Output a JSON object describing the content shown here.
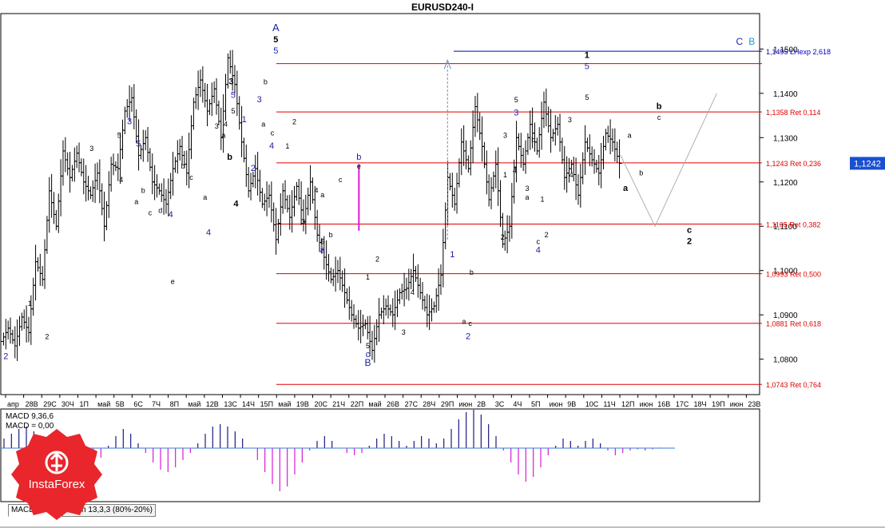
{
  "window": {
    "title": "EURUSD240-I"
  },
  "current_price": "1,1242",
  "tabs": [
    {
      "label": "MACD 9,36,6",
      "active": true
    },
    {
      "label": "Stoch 13,3,3 (80%-20%)",
      "active": false
    }
  ],
  "indicator": {
    "line1": "MACD 9,36,6",
    "line2": "MACD = 0,00"
  },
  "logo_text": "InstaForex",
  "colors": {
    "red_line": "#e00000",
    "blue_line": "#0000c0",
    "label_blue": "#1d1da8",
    "macd_pos": "#1b1b80",
    "macd_neg": "#d81bd8",
    "logo_red": "#e8262c"
  },
  "chart_data": {
    "type": "ohlc",
    "symbol": "EURUSD240-I",
    "y_ticks": [
      "1,1500",
      "1,1400",
      "1,1300",
      "1,1200",
      "1,1100",
      "1,1000",
      "1,0900",
      "1,0800"
    ],
    "ylim": [
      1.072,
      1.158
    ],
    "x_ticks": [
      "апр",
      "28В",
      "29С",
      "30Ч",
      "1П",
      "май",
      "5В",
      "6С",
      "7Ч",
      "8П",
      "май",
      "12В",
      "13С",
      "14Ч",
      "15П",
      "май",
      "19В",
      "20С",
      "21Ч",
      "22П",
      "май",
      "26В",
      "27С",
      "28Ч",
      "29П",
      "июн",
      "2В",
      "3С",
      "4Ч",
      "5П",
      "июн",
      "9В",
      "10С",
      "11Ч",
      "12П",
      "июн",
      "16В",
      "17С",
      "18Ч",
      "19П",
      "июн",
      "23В"
    ],
    "levels": [
      {
        "price": 1.1495,
        "label": "1,1495 LHexp 2,618",
        "color": "blue"
      },
      {
        "price": 1.1467,
        "label": "",
        "color": "red"
      },
      {
        "price": 1.1358,
        "label": "1,1358 Ret 0,114",
        "color": "red"
      },
      {
        "price": 1.1243,
        "label": "1,1243 Ret 0,236",
        "color": "red"
      },
      {
        "price": 1.1105,
        "label": "1,1105 Ret 0,382",
        "color": "red"
      },
      {
        "price": 1.0993,
        "label": "1,0993 Ret 0,500",
        "color": "red"
      },
      {
        "price": 1.0881,
        "label": "1,0881 Ret 0,618",
        "color": "red"
      },
      {
        "price": 1.0743,
        "label": "1,0743 Ret 0,764",
        "color": "red"
      }
    ],
    "price_path": [
      [
        0,
        1.084
      ],
      [
        1,
        1.087
      ],
      [
        2,
        1.083
      ],
      [
        3,
        1.0895
      ],
      [
        4,
        1.086
      ],
      [
        5,
        1.102
      ],
      [
        6,
        1.098
      ],
      [
        7,
        1.118
      ],
      [
        8,
        1.11
      ],
      [
        9,
        1.127
      ],
      [
        10,
        1.121
      ],
      [
        11,
        1.1265
      ],
      [
        12,
        1.12
      ],
      [
        13,
        1.117
      ],
      [
        14,
        1.122
      ],
      [
        15,
        1.11
      ],
      [
        16,
        1.124
      ],
      [
        17,
        1.123
      ],
      [
        18,
        1.136
      ],
      [
        19,
        1.139
      ],
      [
        20,
        1.126
      ],
      [
        21,
        1.13
      ],
      [
        22,
        1.12
      ],
      [
        23,
        1.118
      ],
      [
        24,
        1.115
      ],
      [
        25,
        1.123
      ],
      [
        26,
        1.128
      ],
      [
        27,
        1.122
      ],
      [
        28,
        1.138
      ],
      [
        29,
        1.143
      ],
      [
        30,
        1.136
      ],
      [
        31,
        1.141
      ],
      [
        32,
        1.13
      ],
      [
        33,
        1.148
      ],
      [
        34,
        1.142
      ],
      [
        35,
        1.129
      ],
      [
        36,
        1.118
      ],
      [
        37,
        1.123
      ],
      [
        38,
        1.115
      ],
      [
        39,
        1.117
      ],
      [
        40,
        1.107
      ],
      [
        41,
        1.118
      ],
      [
        42,
        1.112
      ],
      [
        43,
        1.119
      ],
      [
        44,
        1.111
      ],
      [
        45,
        1.12
      ],
      [
        46,
        1.108
      ],
      [
        47,
        1.103
      ],
      [
        48,
        1.098
      ],
      [
        49,
        1.1
      ],
      [
        50,
        1.095
      ],
      [
        51,
        1.09
      ],
      [
        52,
        1.087
      ],
      [
        53,
        1.088
      ],
      [
        54,
        1.082
      ],
      [
        55,
        1.09
      ],
      [
        56,
        1.092
      ],
      [
        57,
        1.09
      ],
      [
        58,
        1.095
      ],
      [
        59,
        1.096
      ],
      [
        60,
        1.1
      ],
      [
        61,
        1.095
      ],
      [
        62,
        1.09
      ],
      [
        63,
        1.092
      ],
      [
        64,
        1.099
      ],
      [
        65,
        1.121
      ],
      [
        66,
        1.115
      ],
      [
        67,
        1.129
      ],
      [
        68,
        1.123
      ],
      [
        69,
        1.137
      ],
      [
        70,
        1.128
      ],
      [
        71,
        1.116
      ],
      [
        72,
        1.124
      ],
      [
        73,
        1.106
      ],
      [
        74,
        1.11
      ],
      [
        75,
        1.13
      ],
      [
        76,
        1.124
      ],
      [
        77,
        1.133
      ],
      [
        78,
        1.127
      ],
      [
        79,
        1.138
      ],
      [
        80,
        1.13
      ],
      [
        81,
        1.133
      ],
      [
        82,
        1.121
      ],
      [
        83,
        1.124
      ],
      [
        84,
        1.117
      ],
      [
        85,
        1.129
      ],
      [
        86,
        1.125
      ],
      [
        87,
        1.122
      ],
      [
        88,
        1.131
      ],
      [
        89,
        1.129
      ],
      [
        90,
        1.1242
      ]
    ],
    "projection": [
      [
        90,
        1.126
      ],
      [
        95,
        1.11
      ],
      [
        104,
        1.14
      ]
    ],
    "macd_histogram": [
      0.4,
      0.6,
      0.8,
      0.9,
      0.7,
      0.4,
      0.1,
      -0.3,
      -0.7,
      -1.0,
      -1.2,
      -1.1,
      -0.8,
      -0.4,
      0.1,
      0.5,
      0.8,
      0.6,
      0.2,
      -0.2,
      -0.6,
      -0.9,
      -1.0,
      -0.8,
      -0.5,
      -0.2,
      0.2,
      0.6,
      0.9,
      1.0,
      0.9,
      0.7,
      0.4,
      0.0,
      -0.5,
      -1.0,
      -1.5,
      -1.8,
      -1.6,
      -1.1,
      -0.6,
      -0.1,
      0.3,
      0.5,
      0.3,
      0.0,
      -0.2,
      -0.3,
      -0.2,
      0.1,
      0.4,
      0.6,
      0.5,
      0.3,
      0.1,
      0.3,
      0.5,
      0.4,
      0.2,
      0.4,
      0.8,
      1.2,
      1.5,
      1.6,
      1.4,
      1.0,
      0.5,
      -0.1,
      -0.6,
      -1.1,
      -1.4,
      -1.2,
      -0.8,
      -0.3,
      0.1,
      0.4,
      0.3,
      0.1,
      0.3,
      0.4,
      0.2,
      -0.1,
      -0.3,
      -0.2,
      -0.1,
      -0.05,
      -0.1,
      -0.05,
      0.02,
      0.0,
      0.0
    ],
    "wave_labels": [
      {
        "x": 0.5,
        "p": 1.08,
        "t": "2",
        "c": "blue",
        "s": 11
      },
      {
        "x": 4,
        "p": 1.092,
        "t": "1",
        "c": "black",
        "s": 9
      },
      {
        "x": 6.5,
        "p": 1.0845,
        "t": "2",
        "c": "black",
        "s": 9
      },
      {
        "x": 13,
        "p": 1.127,
        "t": "3",
        "c": "black",
        "s": 9
      },
      {
        "x": 17,
        "p": 1.13,
        "t": "5",
        "c": "black",
        "s": 9
      },
      {
        "x": 18.5,
        "p": 1.133,
        "t": "3",
        "c": "blue",
        "s": 11
      },
      {
        "x": 19.8,
        "p": 1.128,
        "t": "5",
        "c": "blue",
        "s": 11
      },
      {
        "x": 17.3,
        "p": 1.12,
        "t": "4",
        "c": "black",
        "s": 9
      },
      {
        "x": 19.5,
        "p": 1.115,
        "t": "a",
        "c": "black",
        "s": 9
      },
      {
        "x": 20.5,
        "p": 1.1175,
        "t": "b",
        "c": "black",
        "s": 9
      },
      {
        "x": 21.5,
        "p": 1.1125,
        "t": "c",
        "c": "black",
        "s": 9
      },
      {
        "x": 23,
        "p": 1.113,
        "t": "d",
        "c": "black",
        "s": 9
      },
      {
        "x": 24.5,
        "p": 1.112,
        "t": "4",
        "c": "blue",
        "s": 11
      },
      {
        "x": 24.8,
        "p": 1.097,
        "t": "e",
        "c": "black",
        "s": 9
      },
      {
        "x": 26.3,
        "p": 1.123,
        "t": "b",
        "c": "black",
        "s": 9
      },
      {
        "x": 27.5,
        "p": 1.1205,
        "t": "c",
        "c": "black",
        "s": 9
      },
      {
        "x": 29.5,
        "p": 1.116,
        "t": "a",
        "c": "black",
        "s": 9
      },
      {
        "x": 30,
        "p": 1.108,
        "t": "4",
        "c": "blue",
        "s": 11
      },
      {
        "x": 31.2,
        "p": 1.132,
        "t": "3",
        "c": "black",
        "s": 9
      },
      {
        "x": 32.5,
        "p": 1.1325,
        "t": "4",
        "c": "black",
        "s": 9
      },
      {
        "x": 33.3,
        "p": 1.142,
        "t": "3",
        "c": "black",
        "s": 11
      },
      {
        "x": 33.6,
        "p": 1.139,
        "t": "5",
        "c": "blue",
        "s": 11
      },
      {
        "x": 33.6,
        "p": 1.1355,
        "t": "5",
        "c": "black",
        "s": 9
      },
      {
        "x": 32.2,
        "p": 1.13,
        "t": "a",
        "c": "black",
        "s": 9
      },
      {
        "x": 33.1,
        "p": 1.125,
        "t": "b",
        "c": "black",
        "s": 11
      },
      {
        "x": 34,
        "p": 1.1145,
        "t": "4",
        "c": "black",
        "s": 11
      },
      {
        "x": 35.2,
        "p": 1.1335,
        "t": "1",
        "c": "blue",
        "s": 11
      },
      {
        "x": 36.5,
        "p": 1.1225,
        "t": "2",
        "c": "blue",
        "s": 11
      },
      {
        "x": 37.4,
        "p": 1.138,
        "t": "3",
        "c": "blue",
        "s": 11
      },
      {
        "x": 39.8,
        "p": 1.154,
        "t": "A",
        "c": "blue",
        "s": 13
      },
      {
        "x": 39.8,
        "p": 1.1515,
        "t": "5",
        "c": "black",
        "s": 11
      },
      {
        "x": 39.8,
        "p": 1.149,
        "t": "5",
        "c": "blue",
        "s": 11
      },
      {
        "x": 38.3,
        "p": 1.142,
        "t": "b",
        "c": "black",
        "s": 9
      },
      {
        "x": 38.0,
        "p": 1.1325,
        "t": "a",
        "c": "black",
        "s": 9
      },
      {
        "x": 39.3,
        "p": 1.1305,
        "t": "c",
        "c": "black",
        "s": 9
      },
      {
        "x": 39.2,
        "p": 1.1275,
        "t": "4",
        "c": "blue",
        "s": 11
      },
      {
        "x": 42.5,
        "p": 1.133,
        "t": "2",
        "c": "black",
        "s": 9
      },
      {
        "x": 41.5,
        "p": 1.1275,
        "t": "1",
        "c": "black",
        "s": 9
      },
      {
        "x": 43.8,
        "p": 1.1105,
        "t": "3",
        "c": "black",
        "s": 9
      },
      {
        "x": 45.7,
        "p": 1.1175,
        "t": "4",
        "c": "black",
        "s": 9
      },
      {
        "x": 46.6,
        "p": 1.1165,
        "t": "a",
        "c": "black",
        "s": 9
      },
      {
        "x": 49.2,
        "p": 1.12,
        "t": "c",
        "c": "black",
        "s": 9
      },
      {
        "x": 46.6,
        "p": 1.106,
        "t": "5",
        "c": "black",
        "s": 9
      },
      {
        "x": 47.8,
        "p": 1.1075,
        "t": "b",
        "c": "black",
        "s": 9
      },
      {
        "x": 46.6,
        "p": 1.104,
        "t": "a",
        "c": "blue",
        "s": 11
      },
      {
        "x": 51.9,
        "p": 1.125,
        "t": "b",
        "c": "blue",
        "s": 11
      },
      {
        "x": 51.9,
        "p": 1.123,
        "t": "e",
        "c": "black",
        "s": 9
      },
      {
        "x": 53.2,
        "p": 1.0785,
        "t": "B",
        "c": "blue",
        "s": 12
      },
      {
        "x": 53.2,
        "p": 1.0805,
        "t": "c",
        "c": "blue",
        "s": 11
      },
      {
        "x": 53.2,
        "p": 1.0825,
        "t": "5",
        "c": "black",
        "s": 9
      },
      {
        "x": 54.6,
        "p": 1.102,
        "t": "2",
        "c": "black",
        "s": 9
      },
      {
        "x": 53.2,
        "p": 1.098,
        "t": "1",
        "c": "black",
        "s": 9
      },
      {
        "x": 58.4,
        "p": 1.0855,
        "t": "3",
        "c": "black",
        "s": 9
      },
      {
        "x": 59.7,
        "p": 1.0945,
        "t": "4",
        "c": "black",
        "s": 9
      },
      {
        "x": 65.5,
        "p": 1.103,
        "t": "1",
        "c": "blue",
        "s": 11
      },
      {
        "x": 67.2,
        "p": 1.088,
        "t": "a",
        "c": "black",
        "s": 9
      },
      {
        "x": 68.1,
        "p": 1.0875,
        "t": "c",
        "c": "black",
        "s": 9
      },
      {
        "x": 68.3,
        "p": 1.099,
        "t": "b",
        "c": "black",
        "s": 9
      },
      {
        "x": 67.8,
        "p": 1.0845,
        "t": "2",
        "c": "blue",
        "s": 11
      },
      {
        "x": 73.2,
        "p": 1.121,
        "t": "1",
        "c": "black",
        "s": 9
      },
      {
        "x": 72.8,
        "p": 1.107,
        "t": "2",
        "c": "black",
        "s": 9
      },
      {
        "x": 73.2,
        "p": 1.13,
        "t": "3",
        "c": "black",
        "s": 9
      },
      {
        "x": 74.8,
        "p": 1.135,
        "t": "3",
        "c": "blue",
        "s": 11
      },
      {
        "x": 74.8,
        "p": 1.138,
        "t": "5",
        "c": "black",
        "s": 9
      },
      {
        "x": 74.6,
        "p": 1.122,
        "t": "4",
        "c": "black",
        "s": 9
      },
      {
        "x": 77.3,
        "p": 1.129,
        "t": "b",
        "c": "black",
        "s": 9
      },
      {
        "x": 76.4,
        "p": 1.116,
        "t": "a",
        "c": "black",
        "s": 9
      },
      {
        "x": 76.4,
        "p": 1.118,
        "t": "3",
        "c": "black",
        "s": 9
      },
      {
        "x": 78.6,
        "p": 1.1155,
        "t": "1",
        "c": "black",
        "s": 9
      },
      {
        "x": 78.0,
        "p": 1.106,
        "t": "c",
        "c": "black",
        "s": 9
      },
      {
        "x": 78.0,
        "p": 1.104,
        "t": "4",
        "c": "blue",
        "s": 11
      },
      {
        "x": 79.2,
        "p": 1.1075,
        "t": "2",
        "c": "black",
        "s": 9
      },
      {
        "x": 82.6,
        "p": 1.1335,
        "t": "3",
        "c": "black",
        "s": 9
      },
      {
        "x": 82.8,
        "p": 1.121,
        "t": "4",
        "c": "black",
        "s": 9
      },
      {
        "x": 85.1,
        "p": 1.148,
        "t": "1",
        "c": "black",
        "s": 11
      },
      {
        "x": 85.1,
        "p": 1.1455,
        "t": "5",
        "c": "blue",
        "s": 11
      },
      {
        "x": 85.1,
        "p": 1.1385,
        "t": "5",
        "c": "black",
        "s": 9
      },
      {
        "x": 91.3,
        "p": 1.13,
        "t": "a",
        "c": "black",
        "s": 9
      },
      {
        "x": 90.7,
        "p": 1.118,
        "t": "a",
        "c": "black",
        "s": 11
      },
      {
        "x": 93.0,
        "p": 1.1215,
        "t": "b",
        "c": "black",
        "s": 9
      },
      {
        "x": 95.6,
        "p": 1.1365,
        "t": "b",
        "c": "black",
        "s": 11
      },
      {
        "x": 95.6,
        "p": 1.134,
        "t": "c",
        "c": "black",
        "s": 9
      },
      {
        "x": 100.0,
        "p": 1.1085,
        "t": "c",
        "c": "black",
        "s": 11
      },
      {
        "x": 100.0,
        "p": 1.106,
        "t": "2",
        "c": "black",
        "s": 11
      },
      {
        "x": 107.3,
        "p": 1.151,
        "t": "C",
        "c": "blue",
        "s": 12
      },
      {
        "x": 109.1,
        "p": 1.151,
        "t": "B",
        "c": "cyan",
        "s": 12
      }
    ]
  }
}
